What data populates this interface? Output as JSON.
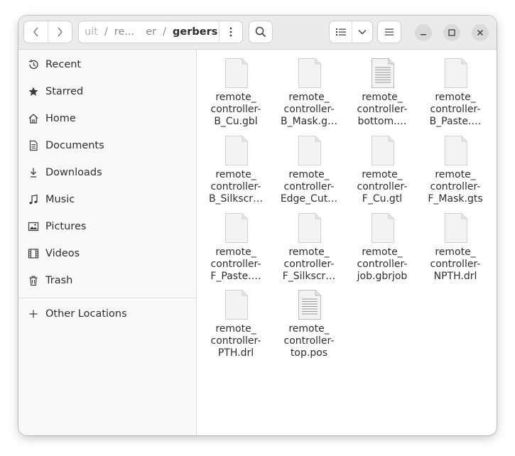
{
  "window": {
    "path": [
      "uit",
      "re...",
      "er",
      "gerbers"
    ],
    "icons": {
      "back": "chevron-left-icon",
      "forward": "chevron-right-icon",
      "path_menu": "vertical-dots-icon",
      "search": "search-icon",
      "view_list": "list-view-icon",
      "view_options": "chevron-down-icon",
      "main_menu": "hamburger-menu-icon",
      "minimize": "minimize-icon",
      "maximize": "maximize-icon",
      "close": "close-icon"
    }
  },
  "sidebar": {
    "items": [
      {
        "label": "Recent",
        "icon": "recent-clock-icon"
      },
      {
        "label": "Starred",
        "icon": "star-icon"
      },
      {
        "label": "Home",
        "icon": "home-icon"
      },
      {
        "label": "Documents",
        "icon": "document-icon"
      },
      {
        "label": "Downloads",
        "icon": "download-icon"
      },
      {
        "label": "Music",
        "icon": "music-note-icon"
      },
      {
        "label": "Pictures",
        "icon": "picture-icon"
      },
      {
        "label": "Videos",
        "icon": "film-icon"
      },
      {
        "label": "Trash",
        "icon": "trash-icon"
      }
    ],
    "other_locations": {
      "label": "Other Locations",
      "icon": "plus-icon"
    }
  },
  "files": [
    {
      "name": "remote_\ncontroller-\nB_Cu.gbl",
      "type": "blank"
    },
    {
      "name": "remote_\ncontroller-\nB_Mask.g…",
      "type": "blank"
    },
    {
      "name": "remote_\ncontroller-\nbottom.…",
      "type": "text"
    },
    {
      "name": "remote_\ncontroller-\nB_Paste.…",
      "type": "blank"
    },
    {
      "name": "remote_\ncontroller-\nB_Silkscr…",
      "type": "blank"
    },
    {
      "name": "remote_\ncontroller-\nEdge_Cut…",
      "type": "blank"
    },
    {
      "name": "remote_\ncontroller-\nF_Cu.gtl",
      "type": "blank"
    },
    {
      "name": "remote_\ncontroller-\nF_Mask.gts",
      "type": "blank"
    },
    {
      "name": "remote_\ncontroller-\nF_Paste.…",
      "type": "blank"
    },
    {
      "name": "remote_\ncontroller-\nF_Silkscr…",
      "type": "blank"
    },
    {
      "name": "remote_\ncontroller-\njob.gbrjob",
      "type": "blank"
    },
    {
      "name": "remote_\ncontroller-\nNPTH.drl",
      "type": "blank"
    },
    {
      "name": "remote_\ncontroller-\nPTH.drl",
      "type": "blank"
    },
    {
      "name": "remote_\ncontroller-\ntop.pos",
      "type": "text"
    }
  ]
}
